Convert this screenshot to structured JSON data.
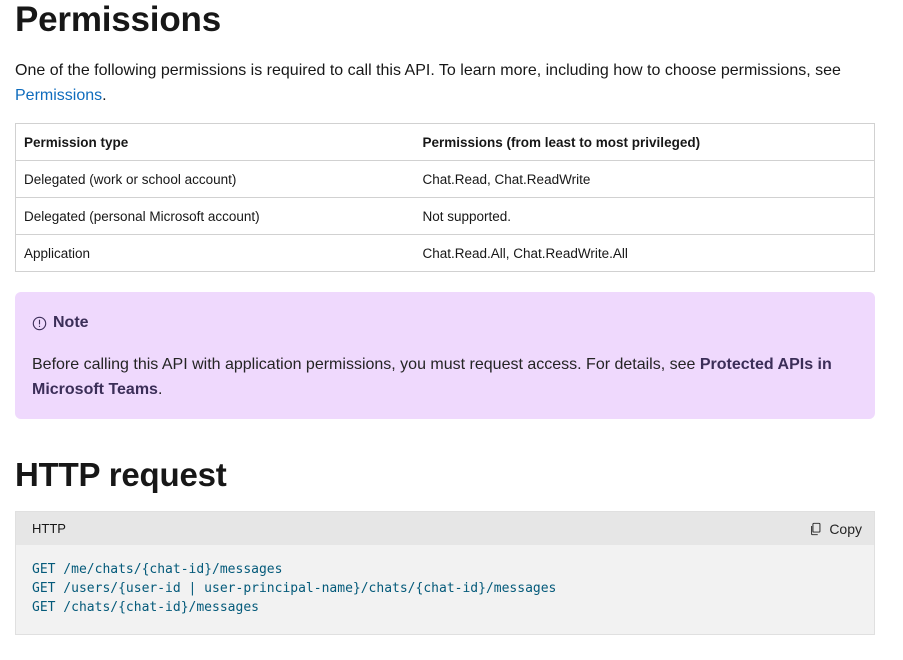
{
  "permissions_section": {
    "title": "Permissions",
    "intro_text": "One of the following permissions is required to call this API. To learn more, including how to choose permissions, see",
    "intro_link": "Permissions",
    "intro_end": "."
  },
  "table": {
    "headers": [
      "Permission type",
      "Permissions (from least to most privileged)"
    ],
    "rows": [
      [
        "Delegated (work or school account)",
        "Chat.Read, Chat.ReadWrite"
      ],
      [
        "Delegated (personal Microsoft account)",
        "Not supported."
      ],
      [
        "Application",
        "Chat.Read.All, Chat.ReadWrite.All"
      ]
    ]
  },
  "note": {
    "title": "Note",
    "body_text": "Before calling this API with application permissions, you must request access. For details, see",
    "body_link": "Protected APIs in Microsoft Teams",
    "body_end": "."
  },
  "http_section": {
    "title": "HTTP request",
    "code_language": "HTTP",
    "copy_label": "Copy",
    "code_lines": [
      "GET /me/chats/{chat-id}/messages",
      "GET /users/{user-id | user-principal-name}/chats/{chat-id}/messages",
      "GET /chats/{chat-id}/messages"
    ]
  },
  "colors": {
    "link": "#0f6cbd",
    "note_background": "#efd9fd",
    "code_text": "#045a7a"
  },
  "icons": {
    "note": "info-circle-icon",
    "copy": "copy-icon"
  }
}
